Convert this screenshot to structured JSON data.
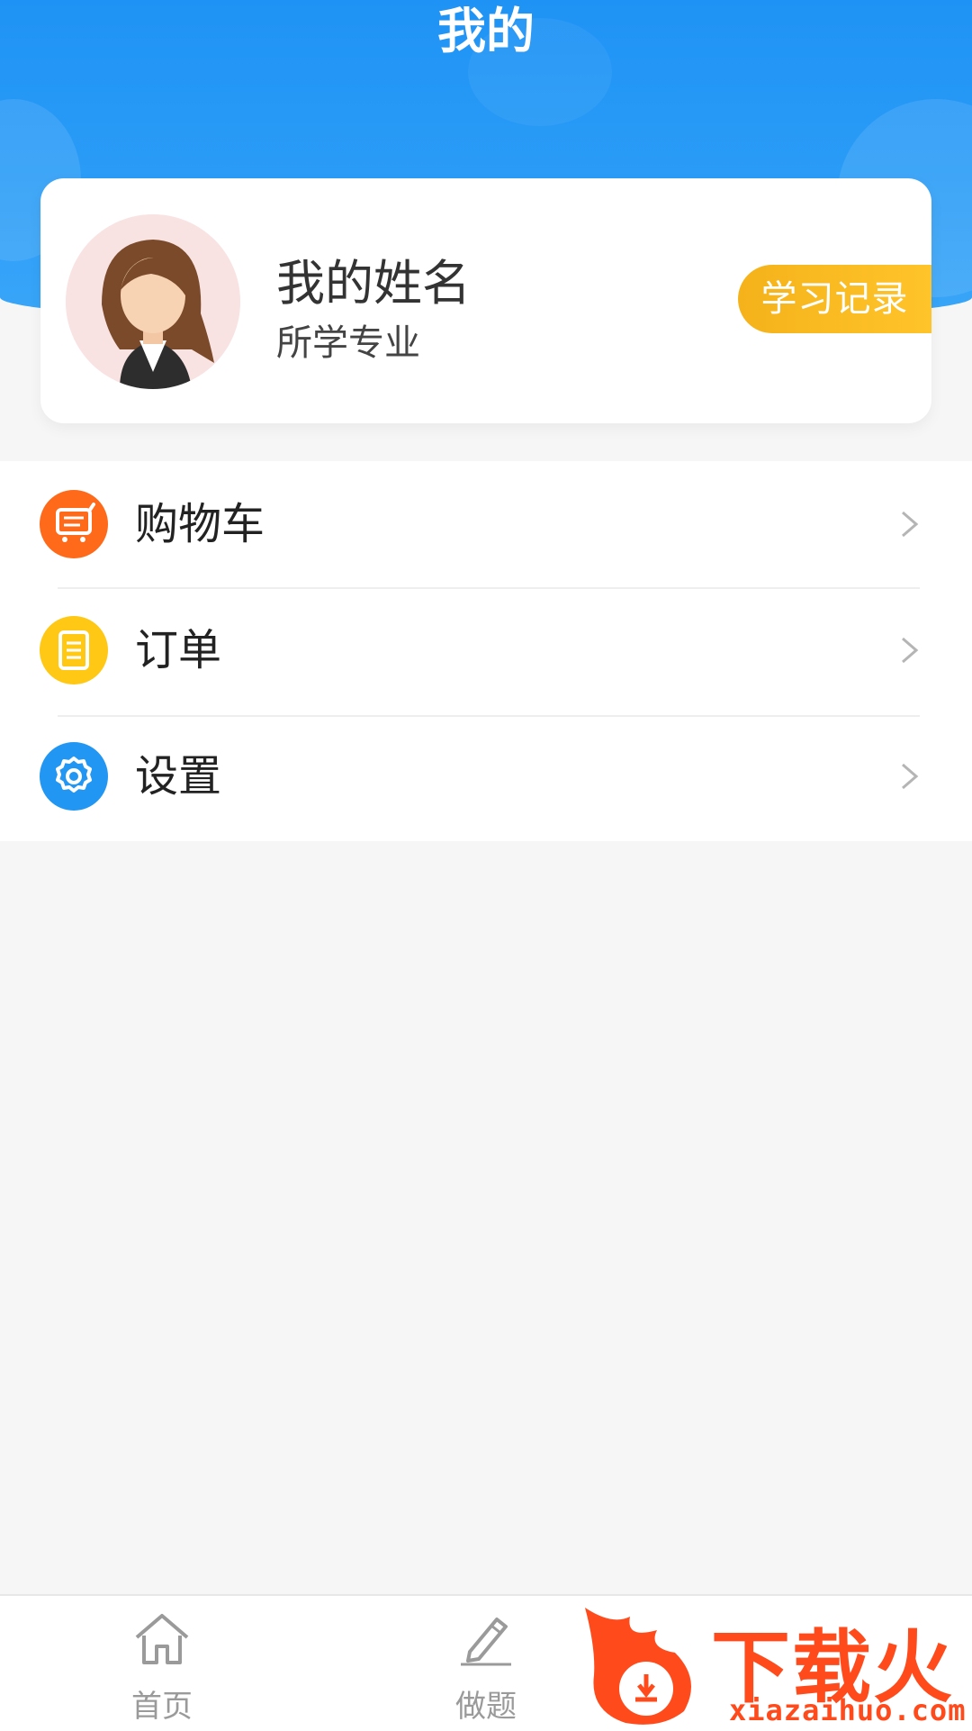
{
  "header": {
    "title": "我的"
  },
  "profile": {
    "name": "我的姓名",
    "major": "所学专业",
    "study_record_label": "学习记录"
  },
  "menu": {
    "items": [
      {
        "label": "购物车",
        "icon": "cart-icon",
        "color": "#ff6a1a"
      },
      {
        "label": "订单",
        "icon": "order-icon",
        "color": "#ffc814"
      },
      {
        "label": "设置",
        "icon": "gear-icon",
        "color": "#2196f3"
      }
    ]
  },
  "tabbar": {
    "tabs": [
      {
        "label": "首页",
        "icon": "home-icon"
      },
      {
        "label": "做题",
        "icon": "pencil-icon"
      }
    ]
  },
  "watermark": {
    "text": "下载火",
    "url": "xiazaihuo.com"
  },
  "colors": {
    "header_blue": "#1f93f5",
    "accent_orange": "#f5b21a"
  }
}
